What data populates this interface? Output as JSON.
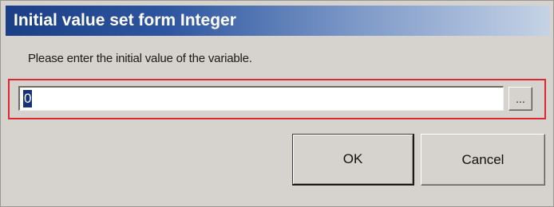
{
  "window": {
    "title": "Initial value set form Integer"
  },
  "prompt": {
    "text": "Please enter the initial value of the variable."
  },
  "input": {
    "value": "0",
    "selected": true
  },
  "browse_button": {
    "label": "..."
  },
  "buttons": {
    "ok_label": "OK",
    "cancel_label": "Cancel"
  },
  "colors": {
    "title_bar_start": "#1b3f86",
    "title_bar_end": "#c6d3e6",
    "dialog_background": "#d6d3ce",
    "highlight_frame": "#e0262f",
    "selection": "#17327a"
  }
}
